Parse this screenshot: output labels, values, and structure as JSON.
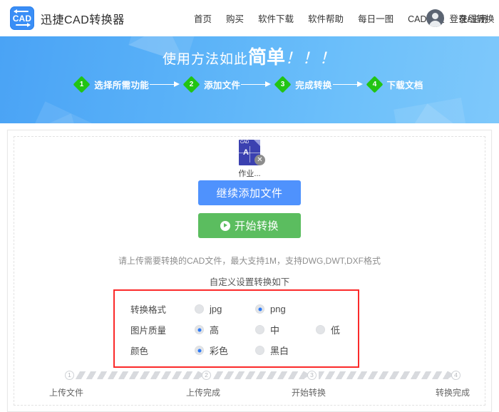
{
  "header": {
    "logo_text": "CAD",
    "brand_name": "迅捷CAD转换器",
    "nav": [
      {
        "label": "首页"
      },
      {
        "label": "购买"
      },
      {
        "label": "软件下载"
      },
      {
        "label": "软件帮助"
      },
      {
        "label": "每日一图"
      },
      {
        "label": "CAD教程"
      },
      {
        "label": "在线转换"
      }
    ],
    "account_label": "登录/注册"
  },
  "banner": {
    "title_prefix": "使用方法如此",
    "title_big": "简单",
    "title_bangs": "！！！",
    "steps": [
      {
        "num": "1",
        "label": "选择所需功能"
      },
      {
        "num": "2",
        "label": "添加文件"
      },
      {
        "num": "3",
        "label": "完成转换"
      },
      {
        "num": "4",
        "label": "下载文档"
      }
    ]
  },
  "upload": {
    "file": {
      "name": "作业...",
      "icon_label": "CAD",
      "glyph": "A",
      "delete_label": "✕"
    },
    "add_button": "继续添加文件",
    "start_button": "开始转换",
    "hint": "请上传需要转换的CAD文件，最大支持1M，支持DWG,DWT,DXF格式",
    "settings_title": "自定义设置转换如下"
  },
  "settings": {
    "accent_color": "#2f7bf6",
    "box_border_color": "#fb2a2a",
    "rows": [
      {
        "label": "转换格式",
        "options": [
          {
            "text": "jpg",
            "selected": false
          },
          {
            "text": "png",
            "selected": true
          }
        ]
      },
      {
        "label": "图片质量",
        "options": [
          {
            "text": "高",
            "selected": true
          },
          {
            "text": "中",
            "selected": false
          },
          {
            "text": "低",
            "selected": false
          }
        ]
      },
      {
        "label": "颜色",
        "options": [
          {
            "text": "彩色",
            "selected": true
          },
          {
            "text": "黑白",
            "selected": false
          }
        ]
      }
    ]
  },
  "progress": {
    "steps": [
      {
        "num": "1",
        "label": "上传文件"
      },
      {
        "num": "2",
        "label": "上传完成"
      },
      {
        "num": "3",
        "label": "开始转换"
      },
      {
        "num": "4",
        "label": "转换完成"
      }
    ]
  },
  "colors": {
    "primary_blue": "#4f92fd",
    "success_green": "#5bbd5f",
    "banner_blue": "#59b1f8",
    "step_green": "#22c413"
  }
}
